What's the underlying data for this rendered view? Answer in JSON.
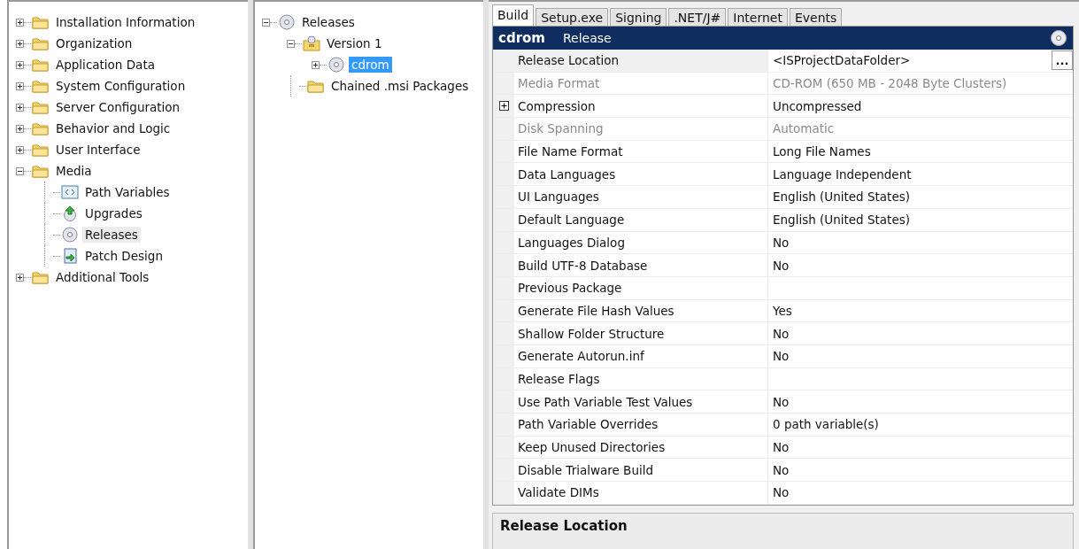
{
  "left_tree": [
    {
      "label": "Installation Information",
      "kind": "folder",
      "expanded": false,
      "selected": false
    },
    {
      "label": "Organization",
      "kind": "folder",
      "expanded": false,
      "selected": false
    },
    {
      "label": "Application Data",
      "kind": "folder",
      "expanded": false,
      "selected": false
    },
    {
      "label": "System Configuration",
      "kind": "folder",
      "expanded": false,
      "selected": false
    },
    {
      "label": "Server Configuration",
      "kind": "folder",
      "expanded": false,
      "selected": false
    },
    {
      "label": "Behavior and Logic",
      "kind": "folder",
      "expanded": false,
      "selected": false
    },
    {
      "label": "User Interface",
      "kind": "folder",
      "expanded": false,
      "selected": false
    },
    {
      "label": "Media",
      "kind": "folder",
      "expanded": true,
      "selected": false,
      "children": [
        {
          "label": "Path Variables",
          "kind": "pathvar",
          "selected": false
        },
        {
          "label": "Upgrades",
          "kind": "upgrade",
          "selected": false
        },
        {
          "label": "Releases",
          "kind": "disc",
          "selected": true
        },
        {
          "label": "Patch Design",
          "kind": "patch",
          "selected": false
        }
      ]
    },
    {
      "label": "Additional Tools",
      "kind": "folder",
      "expanded": false,
      "selected": false
    }
  ],
  "release_tree": [
    {
      "label": "Releases",
      "kind": "disc",
      "expanded": true,
      "selected": false,
      "children": [
        {
          "label": "Version 1",
          "kind": "version",
          "expanded": true,
          "selected": false,
          "children": [
            {
              "label": "cdrom",
              "kind": "disc",
              "expanded": false,
              "selected": true
            }
          ]
        },
        {
          "label": "Chained .msi Packages",
          "kind": "folder",
          "selected": false
        }
      ]
    }
  ],
  "tabs": [
    {
      "label": "Build",
      "selected": true
    },
    {
      "label": "Setup.exe",
      "selected": false
    },
    {
      "label": "Signing",
      "selected": false
    },
    {
      "label": ".NET/J#",
      "selected": false
    },
    {
      "label": "Internet",
      "selected": false
    },
    {
      "label": "Events",
      "selected": false
    }
  ],
  "header": {
    "name": "cdrom",
    "type": "Release"
  },
  "properties": [
    {
      "name": "Release Location",
      "value": "<ISProjectDataFolder>",
      "kind": "plain",
      "disabled": false,
      "selected": true,
      "button": "..."
    },
    {
      "name": "Media Format",
      "value": "CD-ROM (650 MB - 2048 Byte Clusters)",
      "kind": "plain",
      "disabled": true,
      "selected": false
    },
    {
      "name": "Compression",
      "value": "Uncompressed",
      "kind": "group",
      "expanded": false,
      "disabled": false,
      "selected": false
    },
    {
      "name": "Disk Spanning",
      "value": "Automatic",
      "kind": "plain",
      "disabled": true,
      "selected": false
    },
    {
      "name": "File Name Format",
      "value": "Long File Names",
      "kind": "plain",
      "disabled": false,
      "selected": false
    },
    {
      "name": "Data Languages",
      "value": "Language Independent",
      "kind": "plain",
      "disabled": false,
      "selected": false
    },
    {
      "name": "UI Languages",
      "value": "English (United States)",
      "kind": "plain",
      "disabled": false,
      "selected": false
    },
    {
      "name": "Default Language",
      "value": "English (United States)",
      "kind": "plain",
      "disabled": false,
      "selected": false
    },
    {
      "name": "Languages Dialog",
      "value": "No",
      "kind": "plain",
      "disabled": false,
      "selected": false
    },
    {
      "name": "Build UTF-8 Database",
      "value": "No",
      "kind": "plain",
      "disabled": false,
      "selected": false
    },
    {
      "name": "Previous Package",
      "kind": "plain",
      "disabled": false,
      "selected": false
    },
    {
      "name": "Generate File Hash Values",
      "value": "Yes",
      "kind": "plain",
      "disabled": false,
      "selected": false
    },
    {
      "name": "Shallow Folder Structure",
      "value": "No",
      "kind": "plain",
      "disabled": false,
      "selected": false
    },
    {
      "name": "Generate Autorun.inf",
      "value": "No",
      "kind": "plain",
      "disabled": false,
      "selected": false
    },
    {
      "name": "Release Flags",
      "kind": "plain",
      "disabled": false,
      "selected": false
    },
    {
      "name": "Use Path Variable Test Values",
      "value": "No",
      "kind": "plain",
      "disabled": false,
      "selected": false
    },
    {
      "name": "Path Variable Overrides",
      "value": "0 path variable(s)",
      "kind": "plain",
      "disabled": false,
      "selected": false
    },
    {
      "name": "Keep Unused Directories",
      "value": "No",
      "kind": "plain",
      "disabled": false,
      "selected": false
    },
    {
      "name": "Disable Trialware Build",
      "value": "No",
      "kind": "plain",
      "disabled": false,
      "selected": false
    },
    {
      "name": "Validate DIMs",
      "value": "No",
      "kind": "plain",
      "disabled": false,
      "selected": false
    }
  ],
  "description": {
    "title": "Release Location"
  }
}
